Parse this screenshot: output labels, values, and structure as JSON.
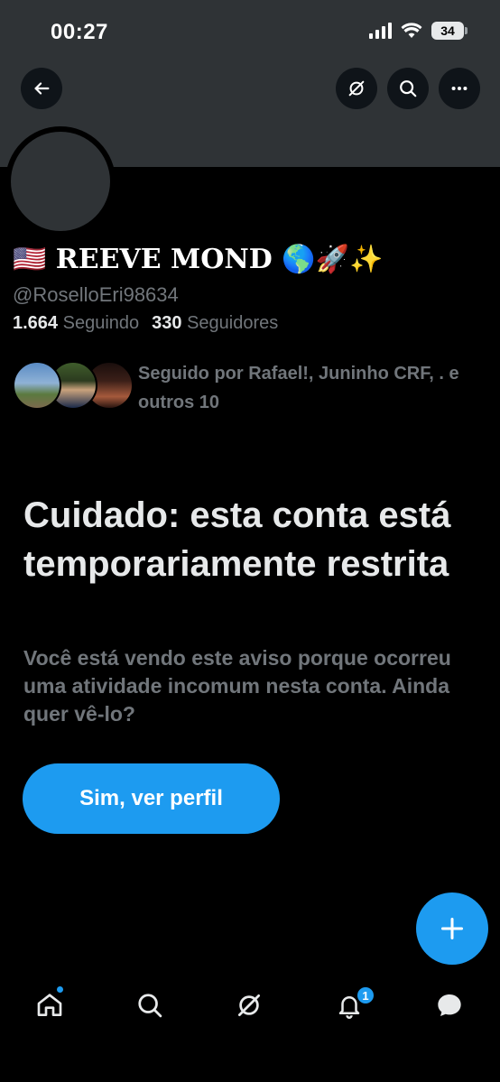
{
  "status_bar": {
    "time": "00:27",
    "battery": "34"
  },
  "profile": {
    "display_name": "🇺🇸 REEVE MOND 🌎🚀✨",
    "handle": "@RoselloEri98634",
    "following_count": "1.664",
    "following_label": "Seguindo",
    "followers_count": "330",
    "followers_label": "Seguidores",
    "followed_by": "Seguido por Rafael!, Juninho CRF, . e outros 10"
  },
  "warning": {
    "title": "Cuidado: esta conta está temporariamente restrita",
    "body": "Você está vendo este aviso porque ocorreu uma atividade incomum nesta conta. Ainda quer vê-lo?",
    "button_label": "Sim, ver perfil"
  },
  "tabbar": {
    "notifications_badge": "1"
  },
  "colors": {
    "accent": "#1d9bf0",
    "banner": "#2f3336",
    "muted_text": "#71767b"
  },
  "icons": [
    "back-arrow-icon",
    "grok-icon",
    "search-icon",
    "more-icon",
    "plus-icon",
    "home-icon",
    "bell-icon",
    "message-icon"
  ]
}
